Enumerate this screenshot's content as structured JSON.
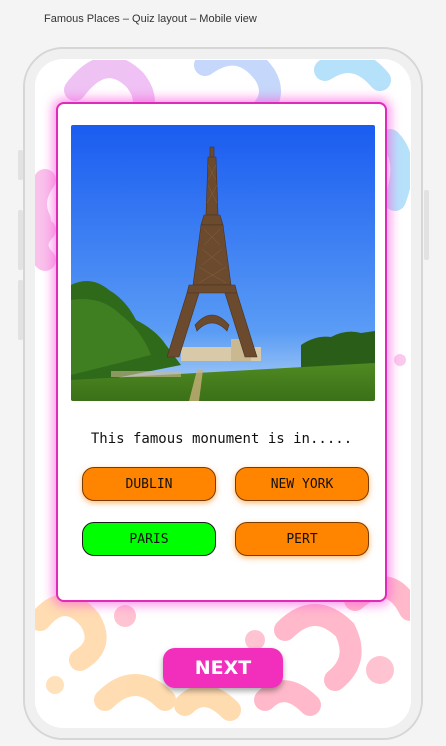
{
  "canvas": {
    "title": "Famous Places – Quiz layout – Mobile view"
  },
  "quiz": {
    "question": "This famous monument is in.....",
    "image_alt": "Eiffel Tower",
    "answers": [
      {
        "label": "DUBLIN",
        "state": "default"
      },
      {
        "label": "NEW YORK",
        "state": "default"
      },
      {
        "label": "PARIS",
        "state": "correct"
      },
      {
        "label": "PERT",
        "state": "default"
      }
    ],
    "next_label": "NEXT"
  },
  "colors": {
    "answer_default": "#ff8400",
    "answer_correct": "#00ff00",
    "next_button": "#f22ebd",
    "card_border": "#e02ab8"
  }
}
